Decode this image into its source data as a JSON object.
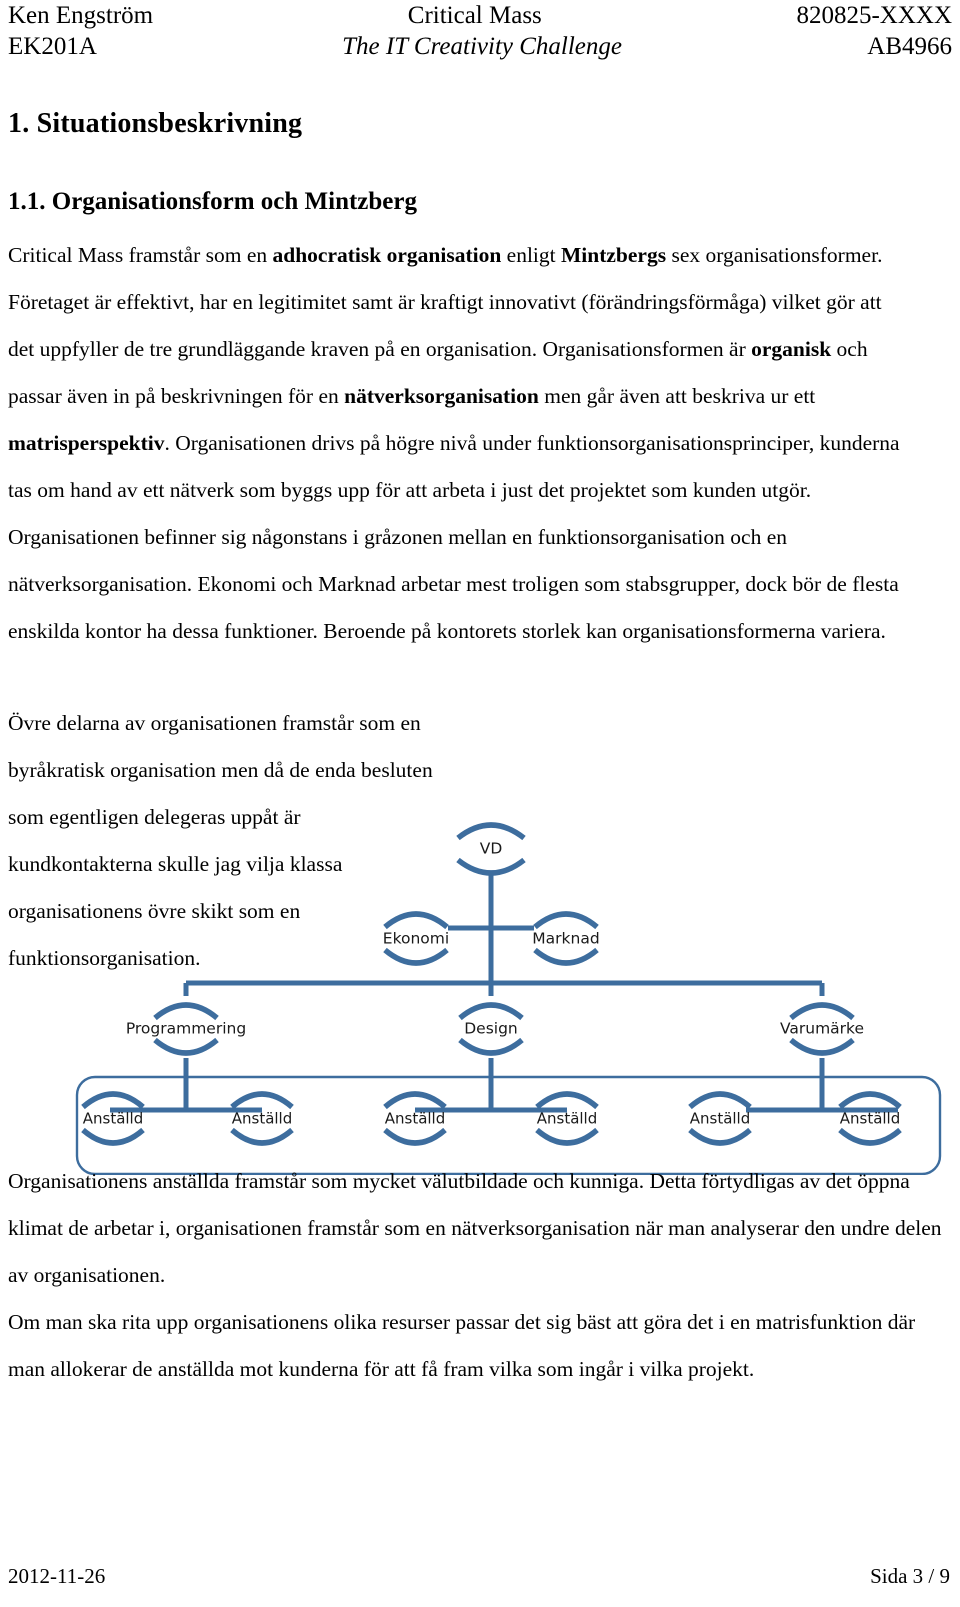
{
  "header": {
    "row1": {
      "left": "Ken Engström",
      "center": "Critical Mass",
      "right": "820825-XXXX"
    },
    "row2": {
      "left": "EK201A",
      "center": "The IT Creativity Challenge",
      "right": "AB4966"
    }
  },
  "headings": {
    "h1": "1. Situationsbeskrivning",
    "h2": "1.1. Organisationsform och Mintzberg"
  },
  "paragraphs": {
    "p1_part1": "Critical Mass framstår som en ",
    "p1_bold1": "adhocratisk organisation",
    "p1_part2": " enligt ",
    "p1_bold2": "Mintzbergs",
    "p1_part3": " sex organisationsformer. Företaget är effektivt, har en legitimitet samt är kraftigt innovativt (förändringsförmåga) vilket gör att det uppfyller de tre grundläggande kraven på en organisation. Organisationsformen är ",
    "p1_bold3": "organisk",
    "p1_part4": " och passar även in på beskrivningen för en ",
    "p1_bold4": "nätverksorganisation",
    "p1_part5": " men går även att beskriva ur ett ",
    "p1_bold5": "matrisperspektiv",
    "p1_part6": ". Organisationen drivs på högre nivå under funktionsorganisationsprinciper, kunderna tas om hand av ett nätverk som byggs upp för att arbeta i just det projektet som kunden utgör. Organisationen befinner sig någonstans i gråzonen mellan en funktionsorganisation och en nätverksorganisation. Ekonomi och Marknad arbetar mest troligen som stabsgrupper, dock bör de flesta enskilda kontor ha dessa funktioner. Beroende på kontorets storlek kan organisationsformerna variera.",
    "p2": "Övre delarna av organisationen framstår som en byråkratisk organisation men då de enda besluten som egentligen delegeras uppåt är kundkontakterna skulle jag vilja klassa organisationens övre skikt som en funktionsorganisation.",
    "p3": "Organisationens anställda framstår som mycket välutbildade och kunniga. Detta förtydligas av det öppna klimat de arbetar i, organisationen framstår som en nätverksorganisation när man analyserar den undre delen av organisationen.",
    "p4": "Om man ska rita upp organisationens olika resurser passar det sig bäst att göra det i en matrisfunktion där man allokerar de anställda mot kunderna för att få fram vilka som ingår i vilka projekt."
  },
  "org_chart": {
    "line_color": "#3d6d9e",
    "box_color": "#3d6d9e",
    "nodes": {
      "ceo": "VD",
      "staff_left": "Ekonomi",
      "staff_right": "Marknad",
      "dept_1": "Programmering",
      "dept_2": "Design",
      "dept_3": "Varumärke",
      "employee_1": "Anställd",
      "employee_2": "Anställd",
      "employee_3": "Anställd",
      "employee_4": "Anställd",
      "employee_5": "Anställd",
      "employee_6": "Anställd"
    }
  },
  "footer": {
    "date": "2012-11-26",
    "page": "Sida 3 / 9"
  }
}
